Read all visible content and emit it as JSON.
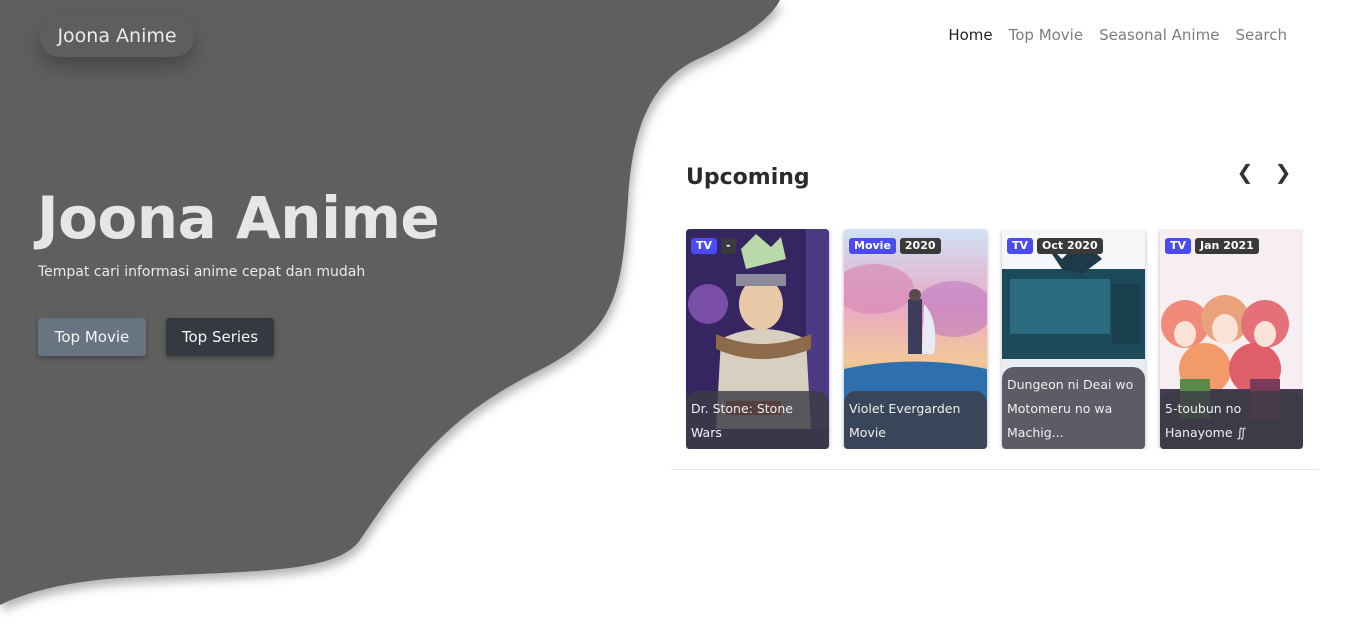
{
  "brand": {
    "title": "Joona Anime"
  },
  "nav": {
    "items": [
      {
        "label": "Home",
        "active": true
      },
      {
        "label": "Top Movie",
        "active": false
      },
      {
        "label": "Seasonal Anime",
        "active": false
      },
      {
        "label": "Search",
        "active": false
      }
    ]
  },
  "hero": {
    "title": "Joona Anime",
    "subtitle": "Tempat cari informasi anime cepat dan mudah",
    "buttons": [
      {
        "label": "Top Movie"
      },
      {
        "label": "Top Series"
      }
    ]
  },
  "upcoming": {
    "title": "Upcoming",
    "prev_icon": "chevron-left-icon",
    "next_icon": "chevron-right-icon",
    "prev_glyph": "❮",
    "next_glyph": "❯",
    "cards": [
      {
        "type": "TV",
        "date": "-",
        "title": "Dr. Stone: Stone Wars"
      },
      {
        "type": "Movie",
        "date": "2020",
        "title": "Violet Evergarden Movie"
      },
      {
        "type": "TV",
        "date": "Oct 2020",
        "title": "Dungeon ni Deai wo Motomeru no wa Machig..."
      },
      {
        "type": "TV",
        "date": "Jan 2021",
        "title": "5-toubun no Hanayome ∬"
      }
    ]
  },
  "colors": {
    "hero_bg": "#5e5e5e",
    "badge_type": "#4b4bf5",
    "badge_date": "#3a3a3a",
    "btn_secondary": "#687482",
    "btn_dark": "#343a40"
  }
}
